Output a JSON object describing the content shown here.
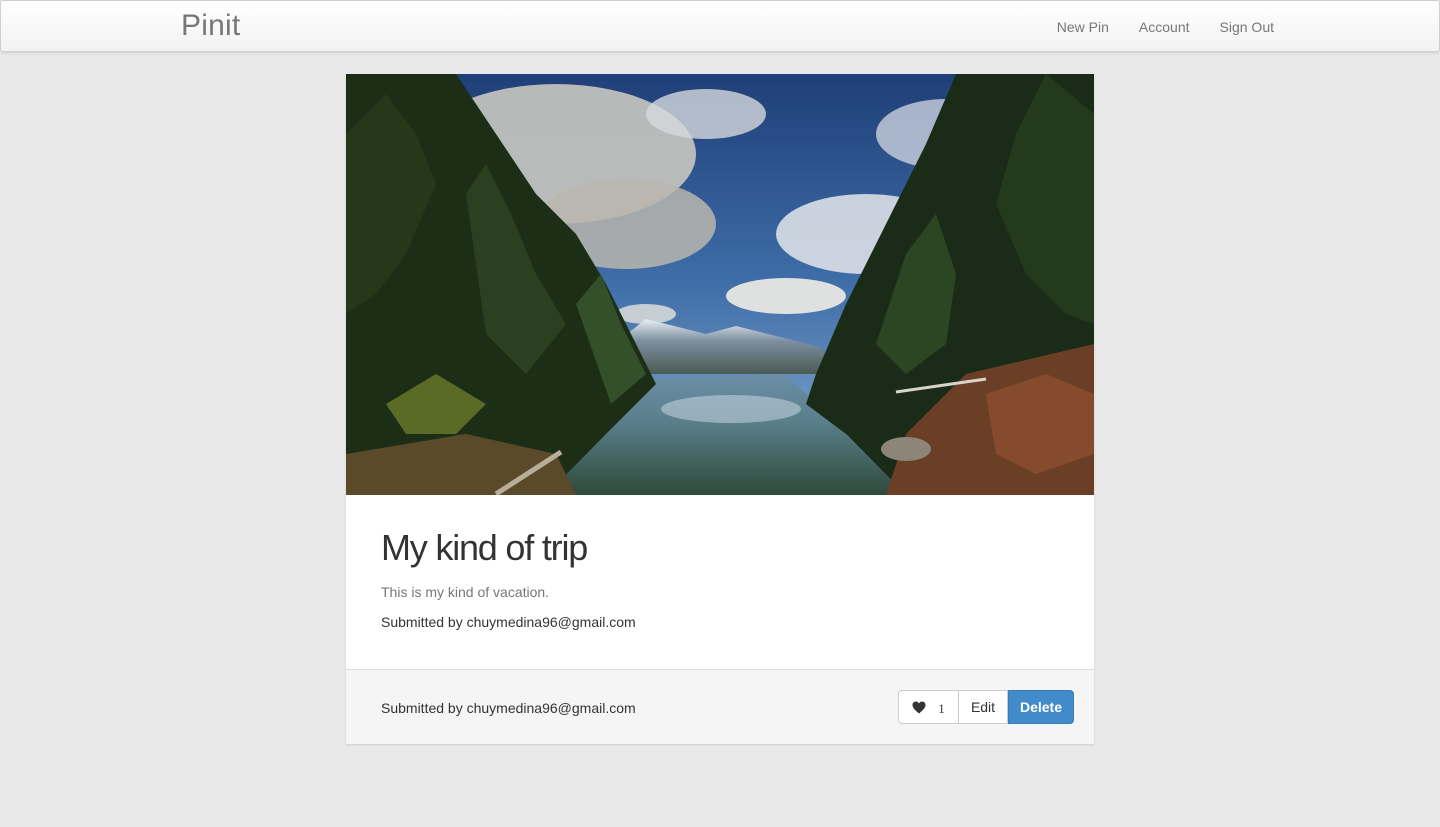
{
  "navbar": {
    "brand": "Pinit",
    "links": [
      "New Pin",
      "Account",
      "Sign Out"
    ]
  },
  "pin": {
    "image_description": "landscape photo",
    "title": "My kind of trip",
    "description": "This is my kind of vacation.",
    "submitted_by": "Submitted by chuymedina96@gmail.com"
  },
  "footer": {
    "submitted_by": "Submitted by chuymedina96@gmail.com",
    "like_icon": "heart-icon",
    "like_count": "1",
    "edit_label": "Edit",
    "delete_label": "Delete",
    "delete_color": "#428bca"
  }
}
